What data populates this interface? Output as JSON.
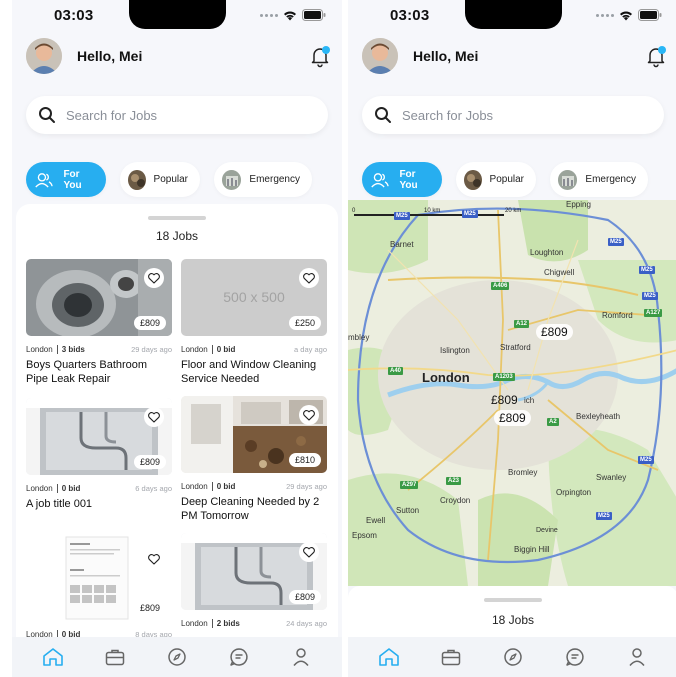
{
  "status": {
    "time": "03:03"
  },
  "header": {
    "greeting": "Hello, Mei"
  },
  "search": {
    "placeholder": "Search for Jobs"
  },
  "chips": [
    {
      "label": "For You",
      "icon": "people-icon"
    },
    {
      "label": "Popular",
      "icon": "popular-thumbnail"
    },
    {
      "label": "Emergency",
      "icon": "emergency-thumbnail"
    }
  ],
  "jobs": {
    "count_label": "18 Jobs",
    "cards": [
      {
        "price": "£809",
        "location": "London",
        "bids": "3 bids",
        "ago": "29 days ago",
        "title": "Boys Quarters Bathroom Pipe Leak Repair",
        "image": "sink-photo"
      },
      {
        "price": "£250",
        "location": "London",
        "bids": "0 bid",
        "ago": "a day ago",
        "title": "Floor and Window Cleaning Service Needed",
        "image": "placeholder",
        "placeholder_text": "500 x 500"
      },
      {
        "price": "£809",
        "location": "London",
        "bids": "0 bid",
        "ago": "6 days ago",
        "title": "A job title 001",
        "image": "pipes-photo"
      },
      {
        "price": "£810",
        "location": "London",
        "bids": "0 bid",
        "ago": "29 days ago",
        "title": "Deep Cleaning Needed by 2 PM Tomorrow",
        "image": "messy-kitchen-photo"
      },
      {
        "price": "£809",
        "location": "London",
        "bids": "0 bid",
        "ago": "8 days ago",
        "title": "",
        "image": "document-photo"
      },
      {
        "price": "£809",
        "location": "London",
        "bids": "2 bids",
        "ago": "24 days ago",
        "title": "",
        "image": "pipes-photo"
      }
    ]
  },
  "map": {
    "scale": {
      "start": "0",
      "mid": "10 km",
      "end": "20 km"
    },
    "places": [
      "Epping",
      "Barnet",
      "Loughton",
      "Chigwell",
      "Romford",
      "Islington",
      "Stratford",
      "London",
      "Bexleyheath",
      "Bromley",
      "Swanley",
      "Orpington",
      "Croydon",
      "Sutton",
      "Ewell",
      "Epsom",
      "Biggin Hill",
      "Devine",
      "mbley",
      "ich"
    ],
    "roads": [
      "M25",
      "M25",
      "M25",
      "M25",
      "M25",
      "M25",
      "A406",
      "A12",
      "A127",
      "A40",
      "A1203",
      "A2",
      "A23",
      "A297",
      "M25"
    ],
    "price_pins": [
      "£809",
      "£809",
      "£809"
    ],
    "jobs_count": "18 Jobs"
  },
  "tabbar": {
    "items": [
      "home-icon",
      "briefcase-icon",
      "compass-icon",
      "chat-icon",
      "profile-icon"
    ]
  },
  "colors": {
    "accent": "#27aef0",
    "notification": "#29b6f6"
  }
}
